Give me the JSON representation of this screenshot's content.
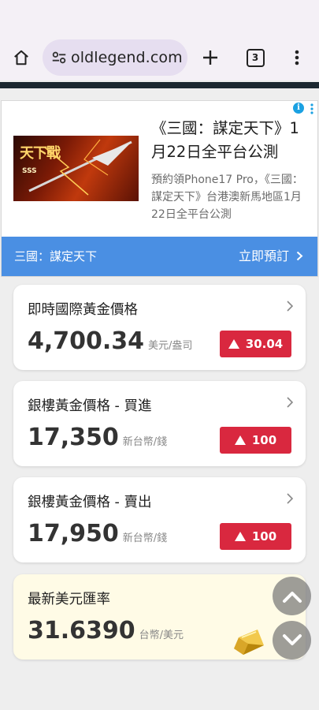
{
  "browser": {
    "url": "oldlegend.com",
    "tab_count": "3",
    "icons": [
      "home-icon",
      "tune-icon",
      "plus-icon",
      "tab-switcher-icon",
      "more-vert-icon"
    ]
  },
  "ad": {
    "image_text_logo": "天下戰",
    "image_text_small": "SSS",
    "title": "《三國：謀定天下》1月22日全平台公測",
    "description": "預約領Phone17 Pro，《三國：謀定天下》台港澳新馬地區1月22日全平台公測",
    "brand": "三國：謀定天下",
    "cta": "立即預訂",
    "accent": "#4a8fe3"
  },
  "cards": [
    {
      "title": "即時國際黃金價格",
      "price": "4,700.34",
      "unit": "美元/盎司",
      "change": "30.04"
    },
    {
      "title": "銀樓黃金價格 - 買進",
      "price": "17,350",
      "unit": "新台幣/錢",
      "change": "100"
    },
    {
      "title": "銀樓黃金價格 - 賣出",
      "price": "17,950",
      "unit": "新台幣/錢",
      "change": "100"
    },
    {
      "title": "最新美元匯率",
      "price": "31.6390",
      "unit": "台幣/美元"
    }
  ],
  "colors": {
    "up": "#d9283f",
    "usd_card": "#fffbe6"
  }
}
